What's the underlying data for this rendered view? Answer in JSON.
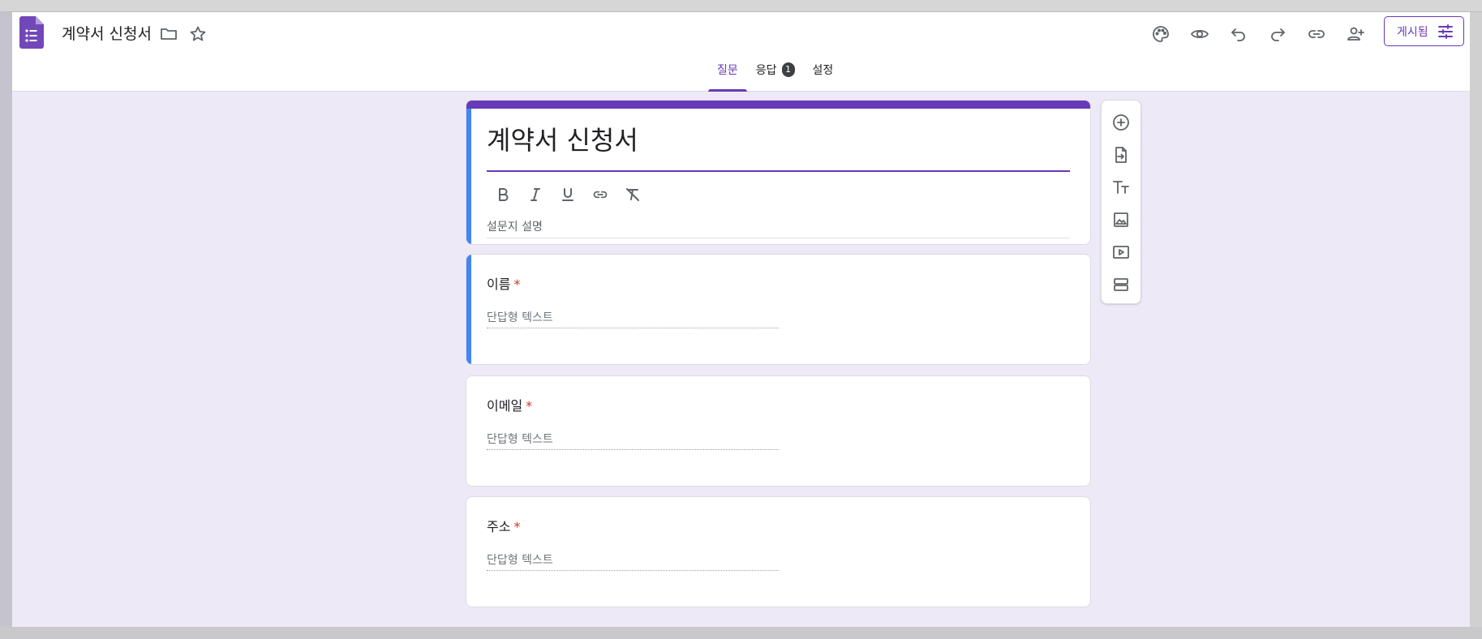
{
  "document": {
    "title": "계약서 신청서"
  },
  "header": {
    "publish_label": "게시됨",
    "icons": [
      "folder-icon",
      "star-icon",
      "palette-icon",
      "eye-icon",
      "undo-icon",
      "redo-icon",
      "link-icon",
      "add-person-icon",
      "tune-icon"
    ],
    "tabs": [
      {
        "label": "질문",
        "active": true
      },
      {
        "label": "응답",
        "badge": "1"
      },
      {
        "label": "설정"
      }
    ]
  },
  "form": {
    "title": "계약서 신청서",
    "description_placeholder": "설문지 설명",
    "formatting_icons": [
      "bold-icon",
      "italic-icon",
      "underline-icon",
      "link-icon",
      "clear-format-icon"
    ],
    "questions": [
      {
        "label": "이름",
        "required_mark": "*",
        "answer_placeholder": "단답형 텍스트",
        "selected": true
      },
      {
        "label": "이메일",
        "required_mark": "*",
        "answer_placeholder": "단답형 텍스트"
      },
      {
        "label": "주소",
        "required_mark": "*",
        "answer_placeholder": "단답형 텍스트"
      }
    ]
  },
  "side_toolbar": {
    "icons": [
      "add-question-icon",
      "import-questions-icon",
      "add-title-icon",
      "add-image-icon",
      "add-video-icon",
      "add-section-icon"
    ]
  },
  "colors": {
    "accent": "#673ab7",
    "selected_bar": "#4285f4",
    "background": "#eee9f6",
    "required": "#d93025"
  }
}
